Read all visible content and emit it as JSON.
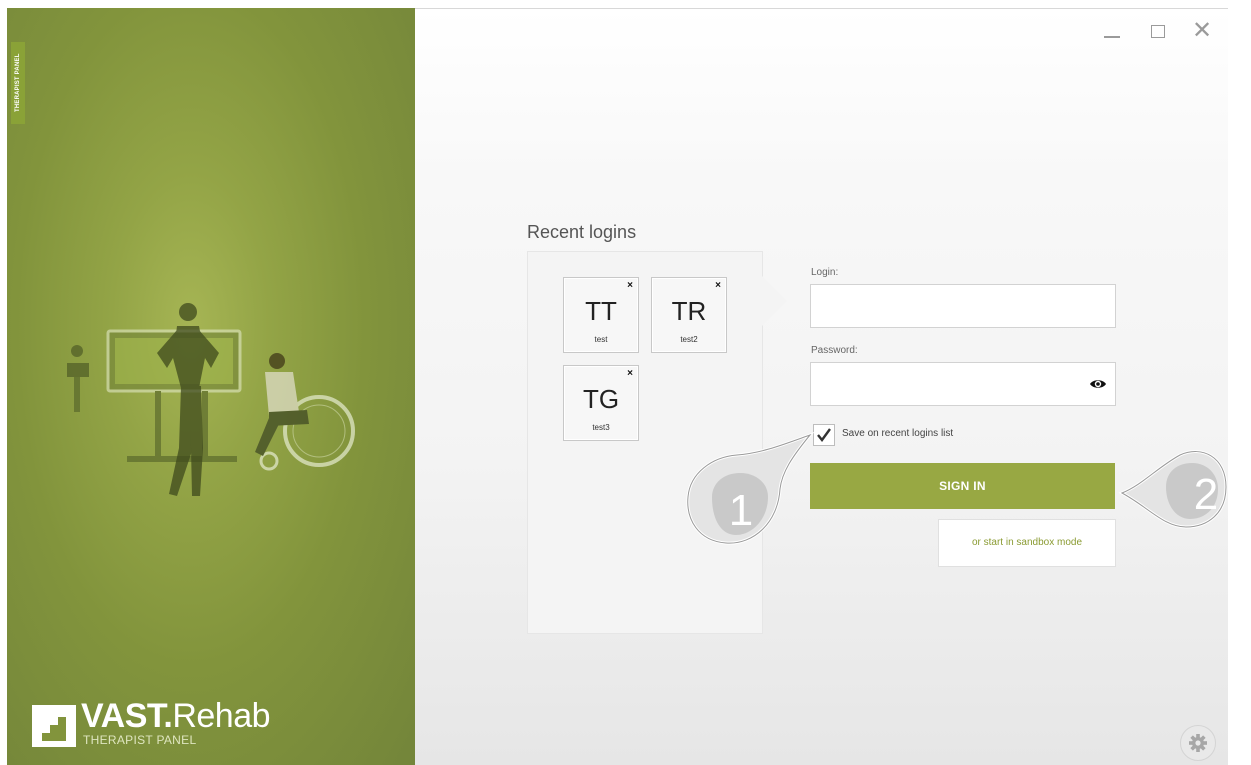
{
  "sidebar": {
    "vertical_tab": "THERAPIST PANEL",
    "logo": {
      "vast": "VAST.",
      "rehab": "Rehab",
      "subtitle": "THERAPIST PANEL"
    }
  },
  "window_controls": {
    "minimize": "minimize-icon",
    "maximize": "maximize-icon",
    "close": "✕"
  },
  "recent": {
    "title": "Recent logins",
    "tiles": [
      {
        "initials": "TT",
        "user": "test",
        "remove": "×"
      },
      {
        "initials": "TR",
        "user": "test2",
        "remove": "×"
      },
      {
        "initials": "TG",
        "user": "test3",
        "remove": "×"
      }
    ]
  },
  "form": {
    "login_label": "Login:",
    "login_value": "",
    "password_label": "Password:",
    "password_value": "",
    "save_label": "Save on recent logins list",
    "save_checked": true,
    "signin_label": "SIGN IN",
    "sandbox_label": "or start in sandbox mode"
  },
  "annotations": {
    "callout1": "1",
    "callout2": "2"
  },
  "colors": {
    "accent": "#98a843",
    "sidebar": "#82943c",
    "link": "#8a9b32"
  }
}
